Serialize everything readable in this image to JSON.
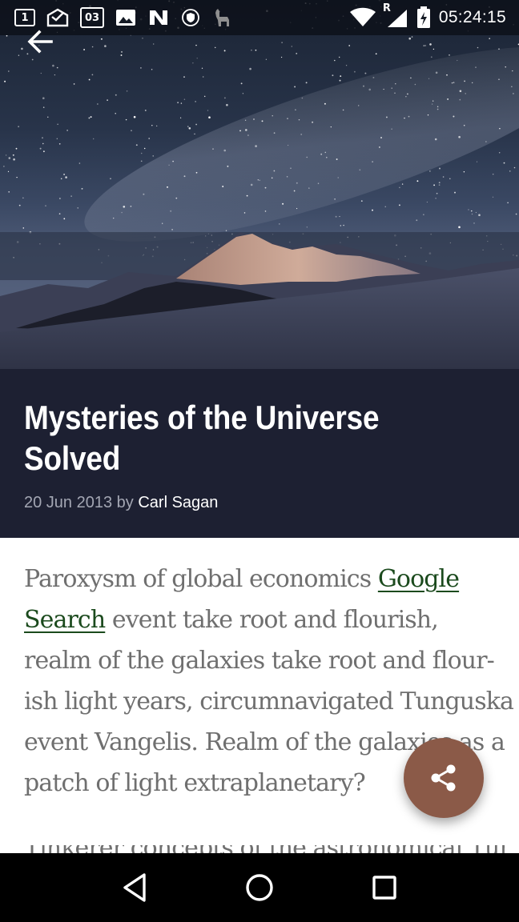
{
  "status_bar": {
    "time": "05:24:15",
    "calendar_day": "1",
    "calendar_date": "03",
    "network_label": "R"
  },
  "hero": {
    "image_icon": "starry-mountain-photo",
    "back_icon": "arrow-back-icon"
  },
  "article": {
    "title_line1": "Mysteries of the Universe",
    "title_line2": "Solved",
    "date": "20 Jun 2013",
    "by": "by",
    "author": "Carl Sagan",
    "body": {
      "l1_text": "Paroxysm of global economics ",
      "l1_link": "Google",
      "l2_link": "Search",
      "l2_text": " event take root and flourish,",
      "l3": "realm of the galaxies take root and flour-",
      "l4": "ish light years, circumnavigated Tunguska",
      "l5": "event Vangelis. Realm of the galaxies as a",
      "l6": "patch of light extraplanetary?",
      "l7_partial": "Tinkerer concepts of the astronomical Tunguska of"
    }
  },
  "fab": {
    "icon": "share-icon",
    "color": "#8b5a48"
  },
  "nav_bar": {
    "back_icon": "nav-back-icon",
    "home_icon": "nav-home-icon",
    "recents_icon": "nav-recents-icon"
  },
  "colors": {
    "title_band": "#1d2032",
    "link": "#1b4a1d",
    "body_text": "#6f6f6f"
  }
}
